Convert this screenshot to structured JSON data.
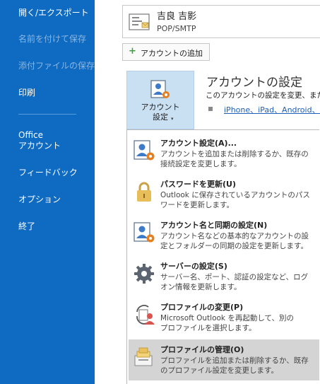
{
  "sidebar": {
    "items": [
      {
        "label": "開く/エクスポート",
        "disabled": false
      },
      {
        "label": "名前を付けて保存",
        "disabled": true
      },
      {
        "label": "添付ファイルの保存",
        "disabled": true
      },
      {
        "label": "印刷",
        "disabled": false
      },
      {
        "label": "Office\nアカウント",
        "disabled": false
      },
      {
        "label": "フィードバック",
        "disabled": false
      },
      {
        "label": "オプション",
        "disabled": false
      },
      {
        "label": "終了",
        "disabled": false
      }
    ]
  },
  "account": {
    "name": "吉良 吉影",
    "type": "POP/SMTP",
    "icon": "account-card-icon"
  },
  "add_account_button": {
    "label": "アカウントの追加",
    "icon": "plus-icon"
  },
  "account_settings_button": {
    "label": "アカウント\n設定",
    "icon": "account-settings-icon",
    "caret": "▾"
  },
  "section": {
    "title": "アカウントの設定",
    "description": "このアカウントの設定を変更、または",
    "link": "iPhone、iPad、Android、W"
  },
  "menu": {
    "items": [
      {
        "title": "アカウント設定(A)...",
        "desc": "アカウントを追加または削除するか、既存の\n接続設定を変更します。",
        "icon": "account-settings-icon"
      },
      {
        "title": "パスワードを更新(U)",
        "desc": "Outlook に保存されているアカウントのパス\nワードを更新します。",
        "icon": "lock-icon"
      },
      {
        "title": "アカウント名と同期の設定(N)",
        "desc": "アカウント名などの基本的なアカウントの設\n定とフォルダーの同期の設定を更新します。",
        "icon": "account-sync-icon"
      },
      {
        "title": "サーバーの設定(S)",
        "desc": "サーバー名、ポート、認証の設定など、ログ\nオン情報を更新します。",
        "icon": "gear-icon"
      },
      {
        "title": "プロファイルの変更(P)",
        "desc": "Microsoft Outlook を再起動して、別の\nプロファイルを選択します。",
        "icon": "profile-change-icon"
      },
      {
        "title": "プロファイルの管理(O)",
        "desc": "プロファイルを追加または削除するか、既存\nのプロファイル設定を変更します。",
        "icon": "profile-manage-icon"
      }
    ]
  },
  "colors": {
    "sidebar": "#0f6ac2",
    "highlight": "#c9dff2",
    "menu_active": "#d4d4d4",
    "link": "#1f5fb7"
  }
}
